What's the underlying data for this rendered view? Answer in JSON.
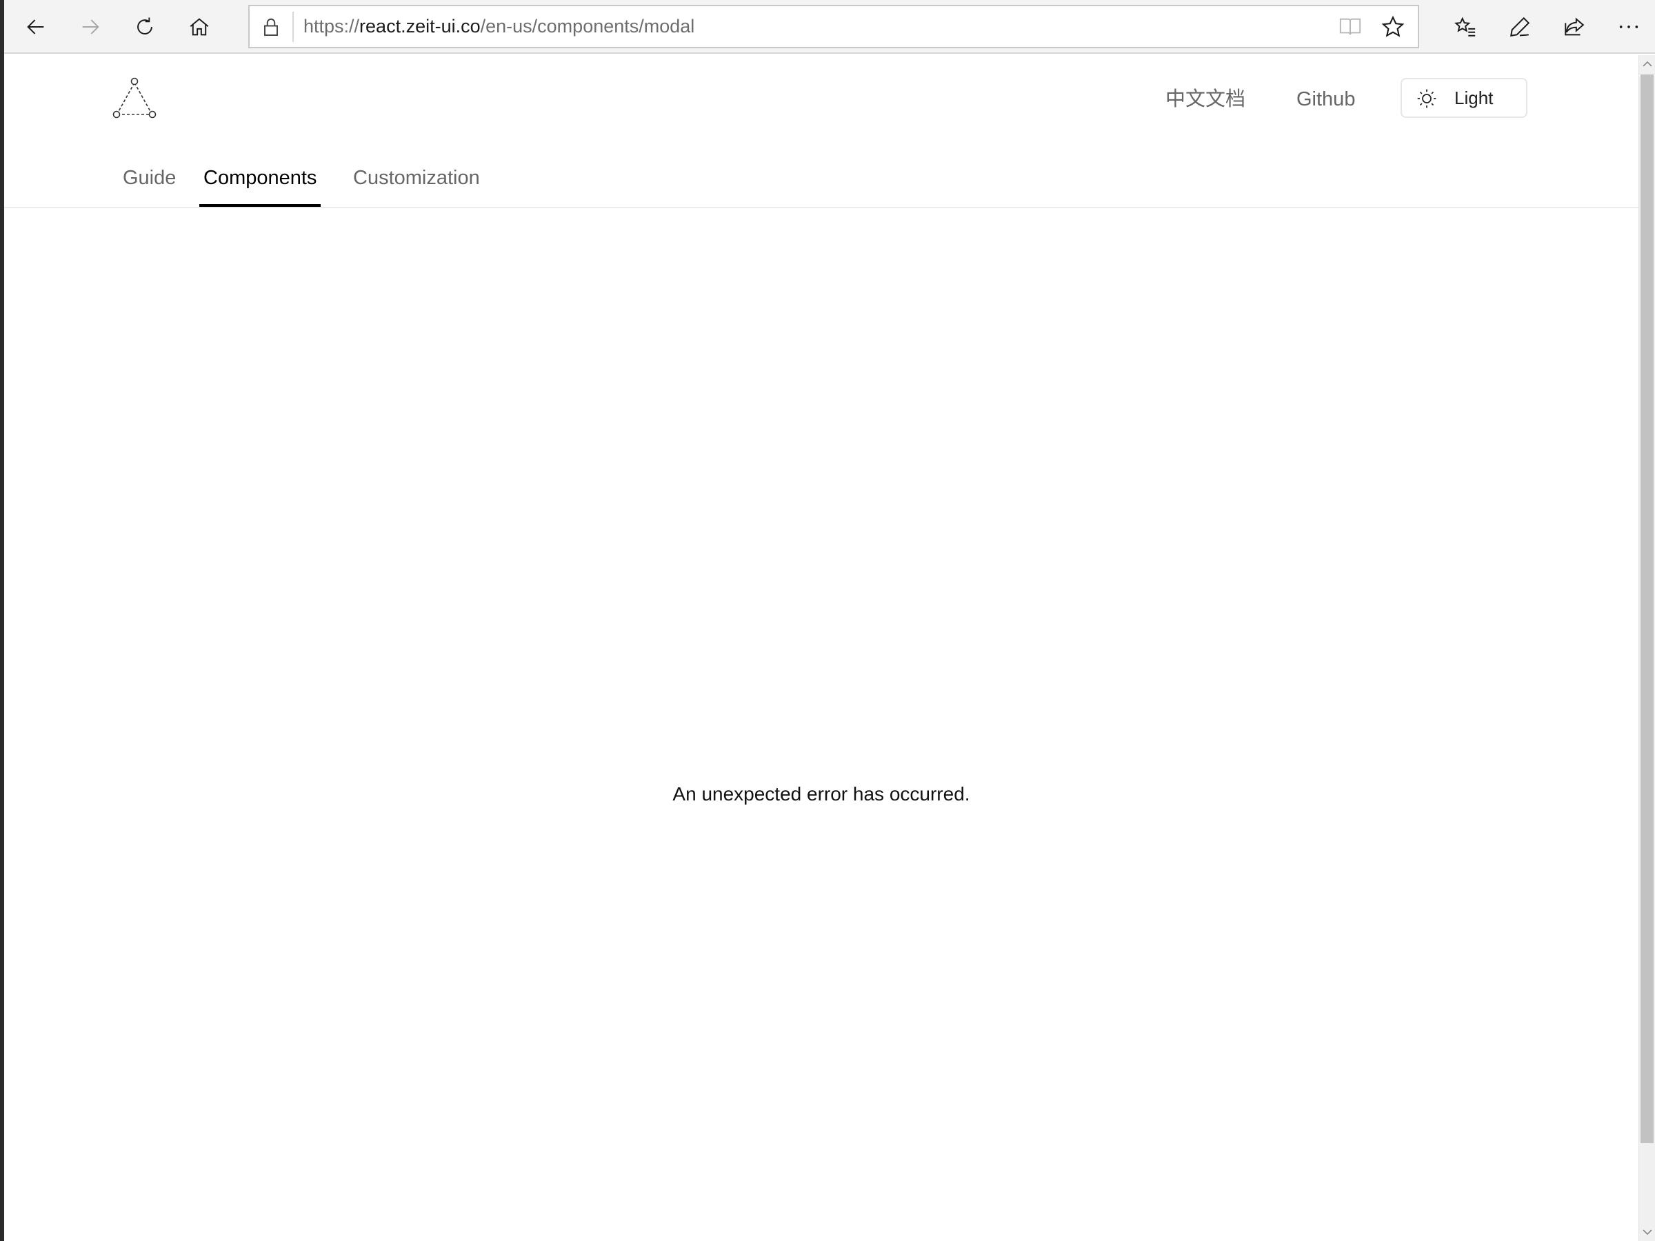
{
  "browser": {
    "url_scheme": "https://",
    "url_host": "react.zeit-ui.co",
    "url_path": "/en-us/components/modal",
    "icons": {
      "back": "back-arrow-icon",
      "forward": "forward-arrow-icon",
      "refresh": "refresh-icon",
      "home": "home-icon",
      "lock": "lock-icon",
      "reading_view": "reading-view-icon",
      "favorite": "star-icon",
      "favorites_list": "favorites-list-icon",
      "pen": "pen-icon",
      "share": "share-icon",
      "more": "more-icon"
    }
  },
  "header": {
    "links": [
      {
        "label": "中文文档"
      },
      {
        "label": "Github"
      }
    ],
    "theme_button": {
      "label": "Light",
      "icon": "sun-icon"
    }
  },
  "tabs": [
    {
      "label": "Guide",
      "active": false
    },
    {
      "label": "Components",
      "active": true
    },
    {
      "label": "Customization",
      "active": false
    }
  ],
  "main": {
    "error_message": "An unexpected error has occurred."
  },
  "colors": {
    "toolbar_bg": "#f3f3f3",
    "active_tab": "#000000",
    "inactive_text": "#666666"
  }
}
